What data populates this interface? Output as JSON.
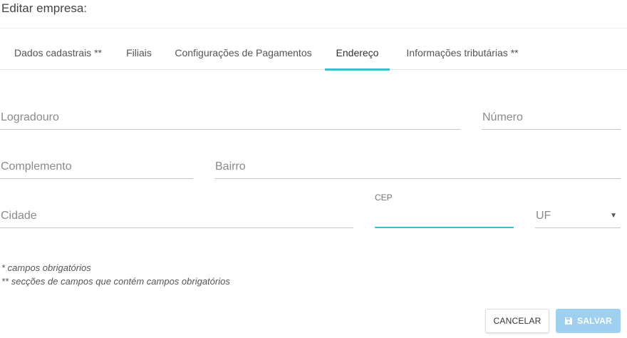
{
  "header": {
    "title": "Editar empresa:"
  },
  "tabs": [
    {
      "label": "Dados cadastrais **"
    },
    {
      "label": "Filiais"
    },
    {
      "label": "Configurações de Pagamentos"
    },
    {
      "label": "Endereço",
      "active": true
    },
    {
      "label": "Informações tributárias **"
    }
  ],
  "form": {
    "logradouro": {
      "placeholder": "Logradouro",
      "value": ""
    },
    "numero": {
      "placeholder": "Número",
      "value": ""
    },
    "complemento": {
      "placeholder": "Complemento",
      "value": ""
    },
    "bairro": {
      "placeholder": "Bairro",
      "value": ""
    },
    "cidade": {
      "placeholder": "Cidade",
      "value": ""
    },
    "cep": {
      "label": "CEP",
      "value": ""
    },
    "uf": {
      "placeholder": "UF",
      "value": ""
    }
  },
  "notes": {
    "required": "* campos obrigatórios",
    "required_sections": "** secções de campos que contém campos obrigatórios"
  },
  "actions": {
    "cancel_label": "CANCELAR",
    "save_label": "SALVAR"
  },
  "colors": {
    "accent": "#3cbfce",
    "save_button": "#9fd0f0"
  }
}
